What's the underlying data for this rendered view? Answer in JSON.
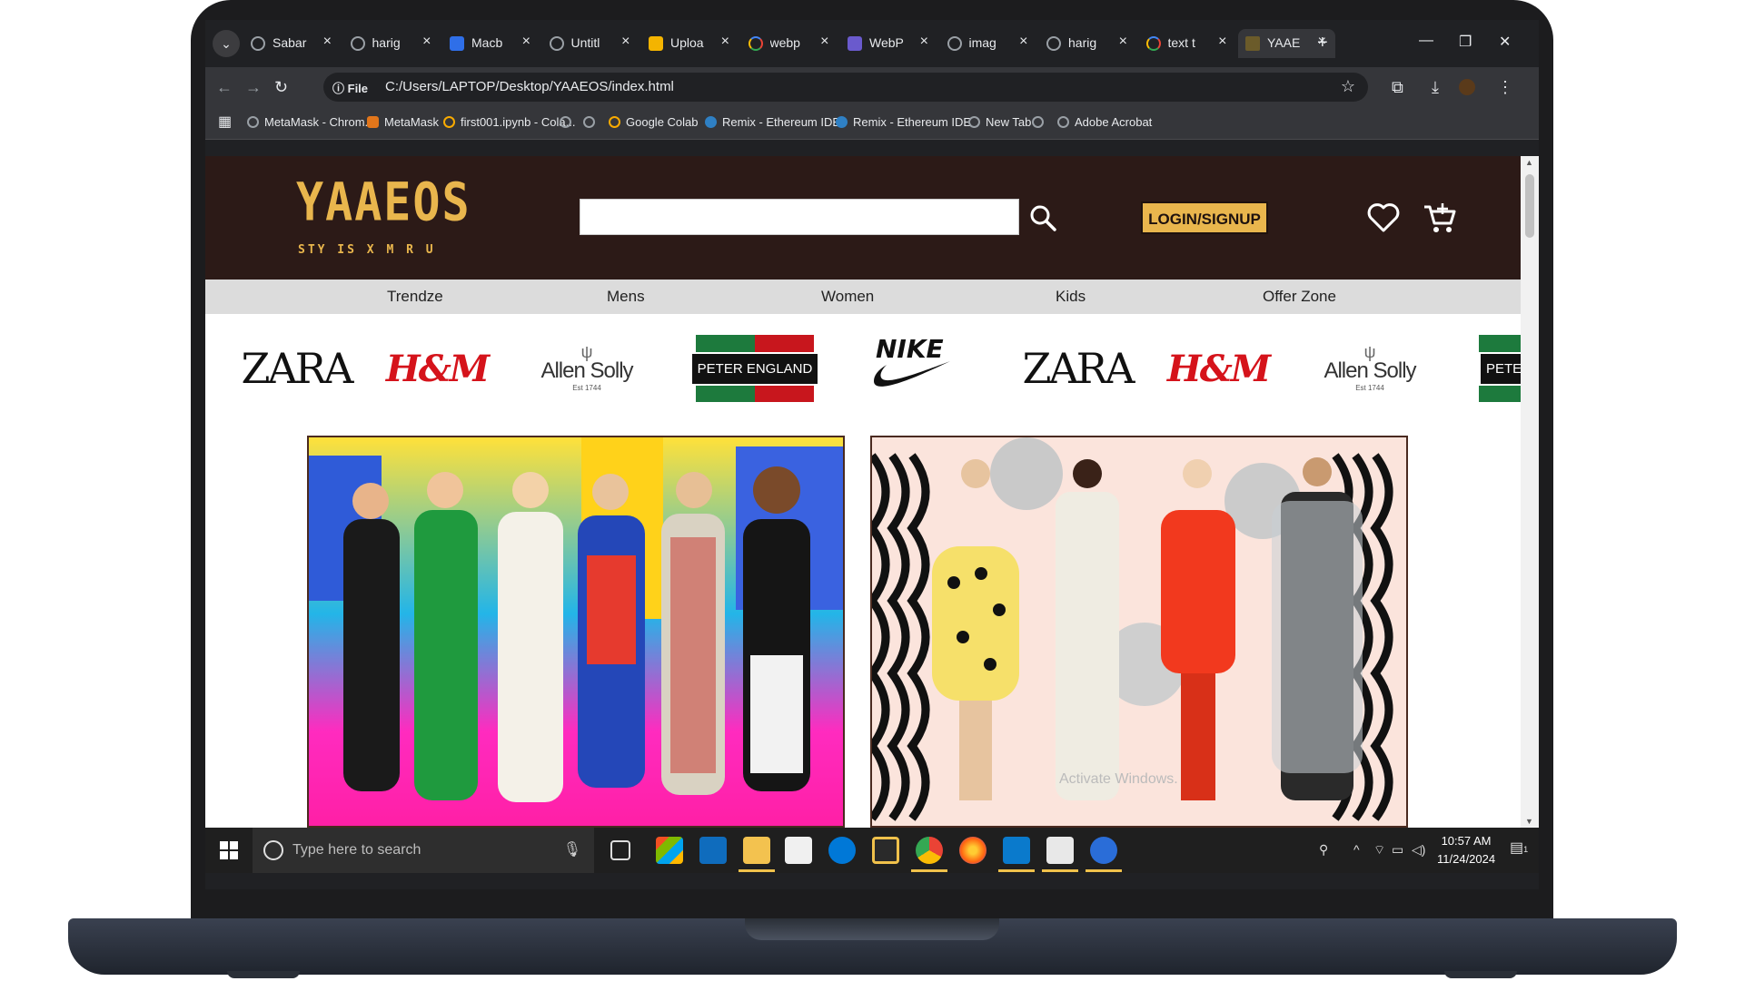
{
  "browser": {
    "tabs": [
      {
        "label": "Sabar",
        "icon": "globe-icon"
      },
      {
        "label": "harig",
        "icon": "globe-icon"
      },
      {
        "label": "Macb",
        "icon": "f-app-icon"
      },
      {
        "label": "Untitl",
        "icon": "c-app-icon"
      },
      {
        "label": "Uploa",
        "icon": "upload-app-icon"
      },
      {
        "label": "webp",
        "icon": "google-icon"
      },
      {
        "label": "WebP",
        "icon": "webp-app-icon"
      },
      {
        "label": "imag",
        "icon": "globe-icon"
      },
      {
        "label": "harig",
        "icon": "globe-icon"
      },
      {
        "label": "text t",
        "icon": "google-icon"
      },
      {
        "label": "YAAE",
        "icon": "yaaeos-icon",
        "active": true
      }
    ],
    "address": {
      "chip": "File",
      "url": "C:/Users/LAPTOP/Desktop/YAAEOS/index.html"
    },
    "bookmarks": [
      {
        "label": "MetaMask - Chrom..."
      },
      {
        "label": "MetaMask"
      },
      {
        "label": "first001.ipynb - Cola..."
      },
      {
        "label": ""
      },
      {
        "label": ""
      },
      {
        "label": "Google Colab"
      },
      {
        "label": "Remix - Ethereum IDE"
      },
      {
        "label": "Remix - Ethereum IDE"
      },
      {
        "label": "New Tab"
      },
      {
        "label": ""
      },
      {
        "label": "Adobe Acrobat"
      }
    ]
  },
  "site": {
    "logo": {
      "main": "YAAEOS",
      "sub": "STY IS X M R U"
    },
    "search": {
      "placeholder": ""
    },
    "login_label": "LOGIN/SIGNUP",
    "nav": [
      "Trendze",
      "Mens",
      "Women",
      "Kids",
      "Offer Zone"
    ],
    "brands": [
      {
        "label": "ZARA",
        "kind": "zara"
      },
      {
        "label": "H&M",
        "kind": "hm"
      },
      {
        "label": "Allen Solly",
        "kind": "allen",
        "est": "Est 1744"
      },
      {
        "label": "PETER ENGLAND",
        "kind": "pe"
      },
      {
        "label": "NIKE",
        "kind": "nike"
      },
      {
        "label": "ZARA",
        "kind": "zara"
      },
      {
        "label": "H&M",
        "kind": "hm"
      },
      {
        "label": "Allen Solly",
        "kind": "allen",
        "est": "Est 1744"
      },
      {
        "label": "PETER",
        "kind": "pe"
      }
    ],
    "watermark": "Activate Windows."
  },
  "taskbar": {
    "search_placeholder": "Type here to search",
    "time": "10:57 AM",
    "date": "11/24/2024",
    "notification_count": "1"
  },
  "colors": {
    "brand_gold": "#e9b64d",
    "header_bg": "#2c1a17",
    "nav_bg": "#dcdcdc"
  }
}
